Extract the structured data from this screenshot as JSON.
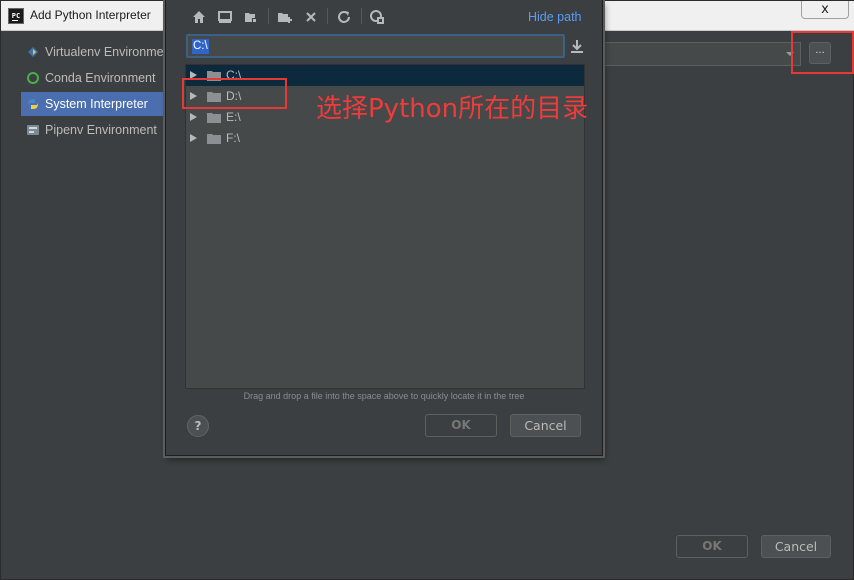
{
  "window": {
    "app_icon_text": "PC",
    "title": "Add Python Interpreter",
    "close_glyph": "x"
  },
  "environments": [
    {
      "label": "Virtualenv Environment",
      "icon": "virtualenv-icon",
      "selected": false
    },
    {
      "label": "Conda Environment",
      "icon": "conda-icon",
      "selected": false
    },
    {
      "label": "System Interpreter",
      "icon": "python-icon",
      "selected": true
    },
    {
      "label": "Pipenv Environment",
      "icon": "pipenv-icon",
      "selected": false
    }
  ],
  "interpreter": {
    "browse_label": "..."
  },
  "outer_buttons": {
    "ok": "OK",
    "cancel": "Cancel"
  },
  "file_dialog": {
    "toolbar_icons": [
      "home-icon",
      "desktop-icon",
      "project-folder-icon",
      "new-folder-icon",
      "delete-icon",
      "refresh-icon",
      "show-hidden-icon"
    ],
    "hide_path_label": "Hide path",
    "path_value": "C:\\",
    "tree": [
      {
        "label": "C:\\",
        "selected": true
      },
      {
        "label": "D:\\",
        "selected": false
      },
      {
        "label": "E:\\",
        "selected": false
      },
      {
        "label": "F:\\",
        "selected": false
      }
    ],
    "hint": "Drag and drop a file into the space above to quickly locate it in the tree",
    "help_label": "?",
    "ok": "OK",
    "cancel": "Cancel"
  },
  "annotation": {
    "text": "选择Python所在的目录",
    "color": "#e53935"
  },
  "colors": {
    "background": "#3c3f41",
    "selection": "#4b6eaf",
    "link": "#589df6"
  }
}
